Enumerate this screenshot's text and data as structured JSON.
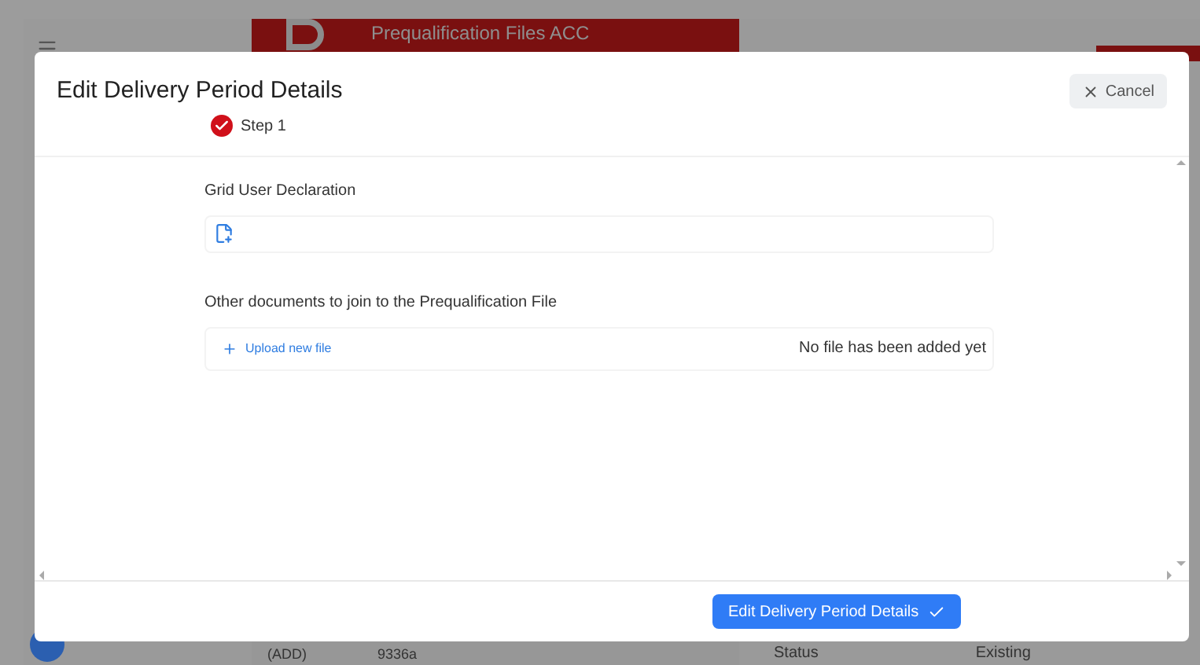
{
  "background": {
    "header_title": "Prequalification Files ACC",
    "row_cells": [
      "(ADD)",
      "9336a"
    ],
    "status_label": "Status",
    "status_value": "Existing"
  },
  "dialog": {
    "title": "Edit Delivery Period Details",
    "cancel": "Cancel",
    "steps": [
      {
        "label": "Step 1",
        "done": true
      }
    ],
    "sections": [
      {
        "kind": "declaration",
        "label": "Grid User Declaration"
      },
      {
        "kind": "documents",
        "label": "Other documents to join to the Prequalification File",
        "upload": "Upload new file",
        "empty": "No file has been added yet"
      }
    ],
    "submit": "Edit Delivery Period Details"
  }
}
